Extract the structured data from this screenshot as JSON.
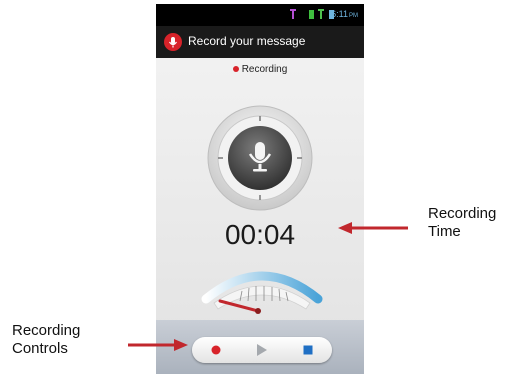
{
  "status_bar": {
    "time": "6:11",
    "time_suffix": "PM"
  },
  "header": {
    "title": "Record your message",
    "icon": "microphone-icon"
  },
  "recorder": {
    "status_text": "Recording",
    "elapsed_time": "00:04",
    "dial_icon": "microphone-icon"
  },
  "controls": {
    "record_icon": "record-icon",
    "play_icon": "play-icon",
    "stop_icon": "stop-icon"
  },
  "annotations": {
    "time_label_line1": "Recording",
    "time_label_line2": "Time",
    "controls_label_line1": "Recording",
    "controls_label_line2": "Controls"
  },
  "colors": {
    "record": "#d8232a",
    "stop": "#1f6fc4",
    "play": "#9aa0a6",
    "arrow": "#c1272d",
    "accent": "#6fb6e0"
  }
}
